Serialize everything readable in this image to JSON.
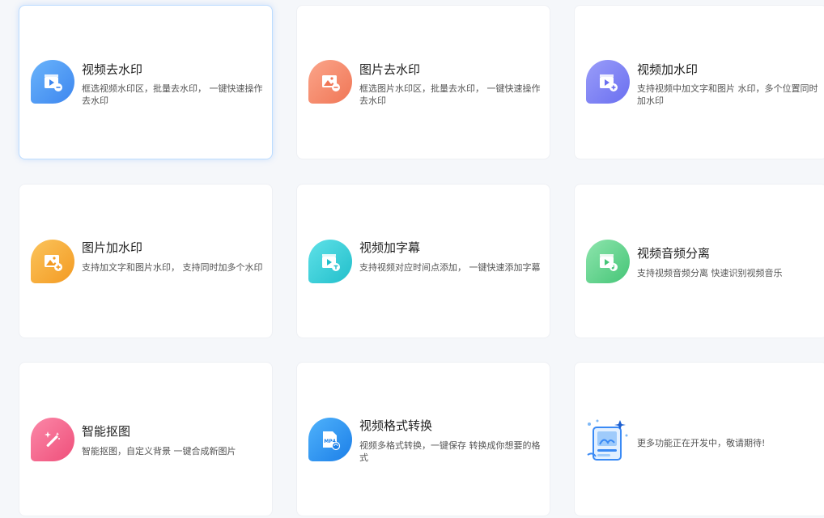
{
  "cards": [
    {
      "title": "视频去水印",
      "desc": "框选视频水印区，批量去水印， 一键快速操作去水印",
      "icon": "video-remove-icon",
      "color": "#4a9cf5"
    },
    {
      "title": "图片去水印",
      "desc": "框选图片水印区，批量去水印， 一键快速操作去水印",
      "icon": "image-remove-icon",
      "color": "#f58a6a"
    },
    {
      "title": "视频加水印",
      "desc": "支持视频中加文字和图片 水印，多个位置同时加水印",
      "icon": "video-add-icon",
      "color": "#7b7ff5"
    },
    {
      "title": "图片加水印",
      "desc": "支持加文字和图片水印， 支持同时加多个水印",
      "icon": "image-add-icon",
      "color": "#f5aa3a"
    },
    {
      "title": "视频加字幕",
      "desc": "支持视频对应时间点添加， 一键快速添加字幕",
      "icon": "video-subtitle-icon",
      "color": "#35cfd8"
    },
    {
      "title": "视频音频分离",
      "desc": "支持视频音频分离 快速识别视频音乐",
      "icon": "video-audio-icon",
      "color": "#5fd28a"
    },
    {
      "title": "智能抠图",
      "desc": "智能抠图，自定义背景 一键合成新图片",
      "icon": "magic-wand-icon",
      "color": "#f5678e"
    },
    {
      "title": "视频格式转换",
      "desc": "视频多格式转换，一键保存 转换成你想要的格式",
      "icon": "mp4-convert-icon",
      "color": "#2f8ff0",
      "badge": "MP4"
    },
    {
      "title": "",
      "desc": "更多功能正在开发中，敬请期待!",
      "icon": "coming-soon-icon",
      "color": "#3a8af5"
    }
  ]
}
